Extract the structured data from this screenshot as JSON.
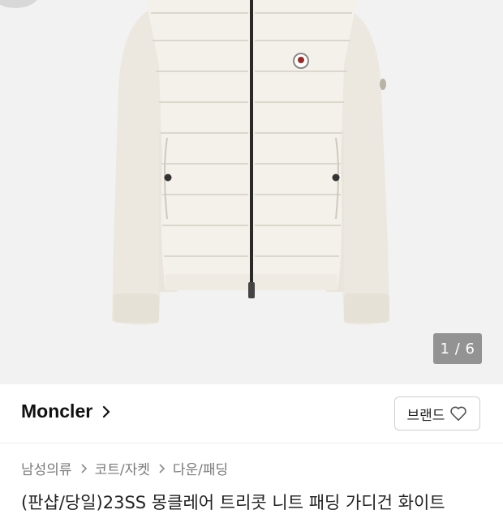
{
  "gallery": {
    "image_alt": "Moncler knit padded cardigan white",
    "counter": "1 / 6"
  },
  "brand": {
    "name": "Moncler",
    "button_label": "브랜드"
  },
  "breadcrumb": [
    "남성의류",
    "코트/자켓",
    "다운/패딩"
  ],
  "product": {
    "title": "(판샵/당일)23SS 몽클레어 트리콧 니트 패딩 가디건 화이트"
  },
  "icons": {
    "brand_chevron": "chevron-right-icon",
    "favorite": "heart-outline-icon",
    "breadcrumb_sep": "chevron-right-icon"
  }
}
